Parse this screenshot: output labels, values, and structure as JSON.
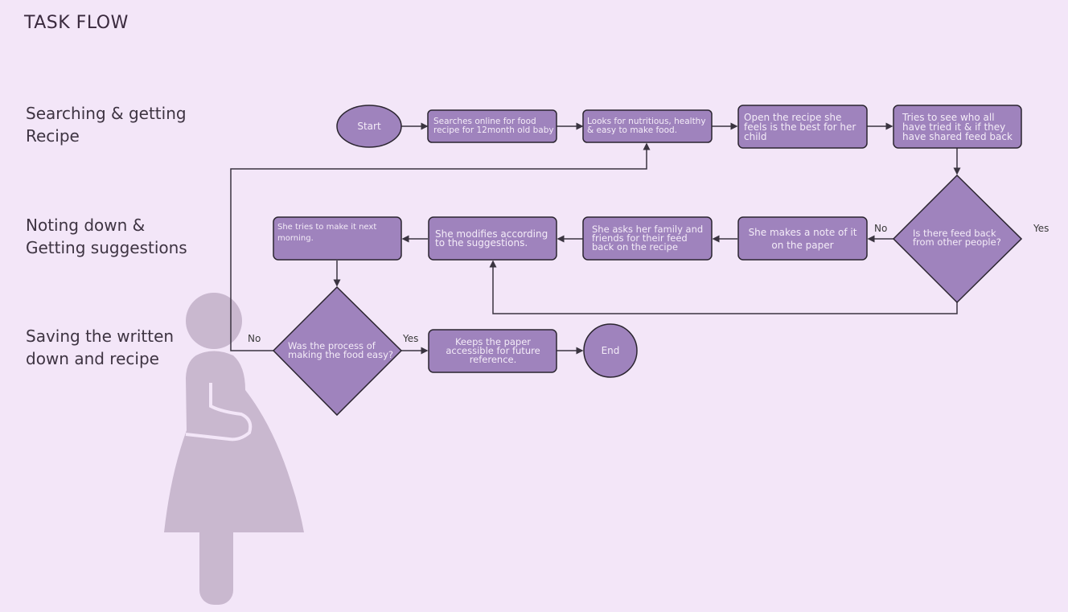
{
  "title": "TASK FLOW",
  "lanes": [
    {
      "label": "Searching & getting\nRecipe"
    },
    {
      "label": "Noting down &\nGetting suggestions"
    },
    {
      "label": "Saving the written\ndown and recipe"
    }
  ],
  "colors": {
    "background": "#f3e6f8",
    "node_fill": "#9f83bd",
    "node_stroke": "#2b2530",
    "node_text": "#f4ecf8",
    "connector": "#3a3440",
    "figure": "#c9b8cf"
  },
  "nodes": {
    "start": "Start",
    "search": "Searches online for food recipe for 12month old baby",
    "looks": "Looks for nutritious, healthy & easy to make food.",
    "open": "Open the recipe she feels is the best for her child",
    "tries": "Tries to see who all have tried it & if they have shared feed back",
    "decision1": "Is there feed back from other people?",
    "note": "She makes a note of it on the paper",
    "asks": "She asks her family and friends for their feed back on the recipe",
    "modifies": "She modifies according to the suggestions.",
    "make": "She tries to make it next morning.",
    "decision2": "Was the process of making the food easy?",
    "keeps": "Keeps the paper accessible for future reference.",
    "end": "End"
  },
  "edge_labels": {
    "d1_no": "No",
    "d1_yes": "Yes",
    "d2_no": "No",
    "d2_yes": "Yes"
  }
}
